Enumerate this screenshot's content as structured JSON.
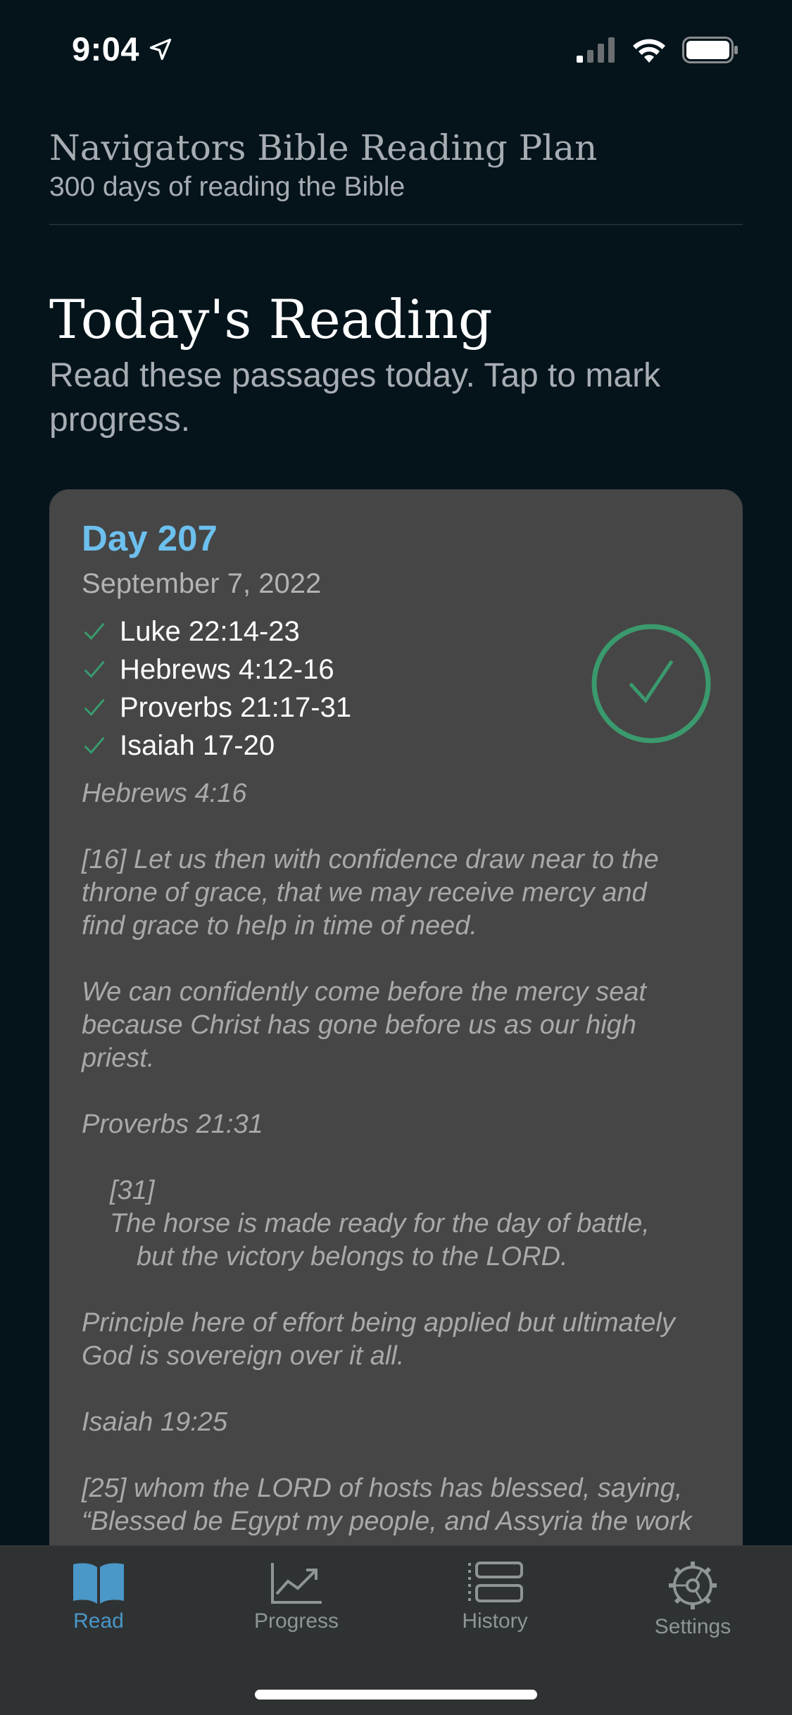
{
  "status_bar": {
    "time": "9:04"
  },
  "header": {
    "title": "Navigators Bible Reading Plan",
    "subtitle": "300 days of reading the Bible"
  },
  "today": {
    "title": "Today's Reading",
    "description": "Read these passages today. Tap to mark progress."
  },
  "card": {
    "day_label": "Day 207",
    "date": "September 7, 2022",
    "passages": [
      {
        "label": "Luke 22:14-23",
        "done": true
      },
      {
        "label": "Hebrews 4:12-16",
        "done": true
      },
      {
        "label": "Proverbs 21:17-31",
        "done": true
      },
      {
        "label": "Isaiah 17-20",
        "done": true
      }
    ],
    "complete": true,
    "notes": {
      "ref1": "Hebrews 4:16",
      "verse1_l1": "[16] Let us then with confidence draw near to the",
      "verse1_l2": "throne of grace, that we may receive mercy and",
      "verse1_l3": "find grace to help in time of need.",
      "comment1_l1": "We can confidently come before the mercy seat",
      "comment1_l2": "because Christ has gone before us as our high",
      "comment1_l3": "priest.",
      "ref2": "Proverbs 21:31",
      "verse2_num": "[31]",
      "verse2_l1": "The horse is made ready for the day of battle,",
      "verse2_l2": "but the victory belongs to the LORD.",
      "comment2_l1": "Principle here of effort being applied but ultimately",
      "comment2_l2": "God is sovereign over it all.",
      "ref3": "Isaiah 19:25",
      "verse3_l1": "[25] whom the LORD of hosts has blessed, saying,",
      "verse3_l2": "“Blessed be Egypt my people, and Assyria the work"
    }
  },
  "tabs": [
    {
      "label": "Read",
      "icon": "book-icon",
      "active": true
    },
    {
      "label": "Progress",
      "icon": "chart-line-icon",
      "active": false
    },
    {
      "label": "History",
      "icon": "list-icon",
      "active": false
    },
    {
      "label": "Settings",
      "icon": "gear-icon",
      "active": false
    }
  ],
  "colors": {
    "background": "#04141a",
    "card": "#464646",
    "accent_blue": "#6cc0ee",
    "check_green": "#3a9a6e",
    "tab_active": "#4a97c8",
    "tab_inactive": "#8f9496"
  }
}
